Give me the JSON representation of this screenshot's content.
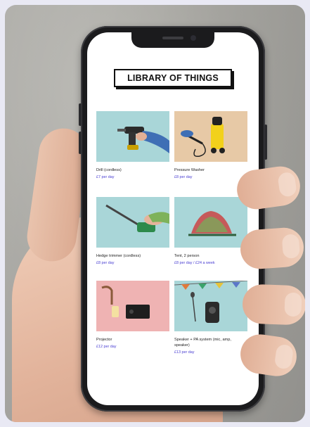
{
  "app": {
    "logo_text": "LIBRARY OF THINGS"
  },
  "products": [
    {
      "title": "Drill (cordless)",
      "price": "£7 per day",
      "icon": "drill-icon"
    },
    {
      "title": "Pressure Washer",
      "price": "£8 per day",
      "icon": "pressure-washer-icon"
    },
    {
      "title": "Hedge trimmer (cordless)",
      "price": "£8 per day",
      "icon": "hedge-trimmer-icon"
    },
    {
      "title": "Tent, 2 person",
      "price": "£8 per day / £24 a week",
      "icon": "tent-icon"
    },
    {
      "title": "Projector",
      "price": "£12 per day",
      "icon": "projector-icon"
    },
    {
      "title": "Speaker + PA system (mic, amp, speaker)",
      "price": "£13 per day",
      "icon": "speaker-icon"
    }
  ],
  "colors": {
    "price": "#4a3fd2",
    "background": "#e9e9f4",
    "tile_blue": "#a9d6d8",
    "tile_beige": "#e7c9a6",
    "tile_pink": "#efb3b3"
  }
}
